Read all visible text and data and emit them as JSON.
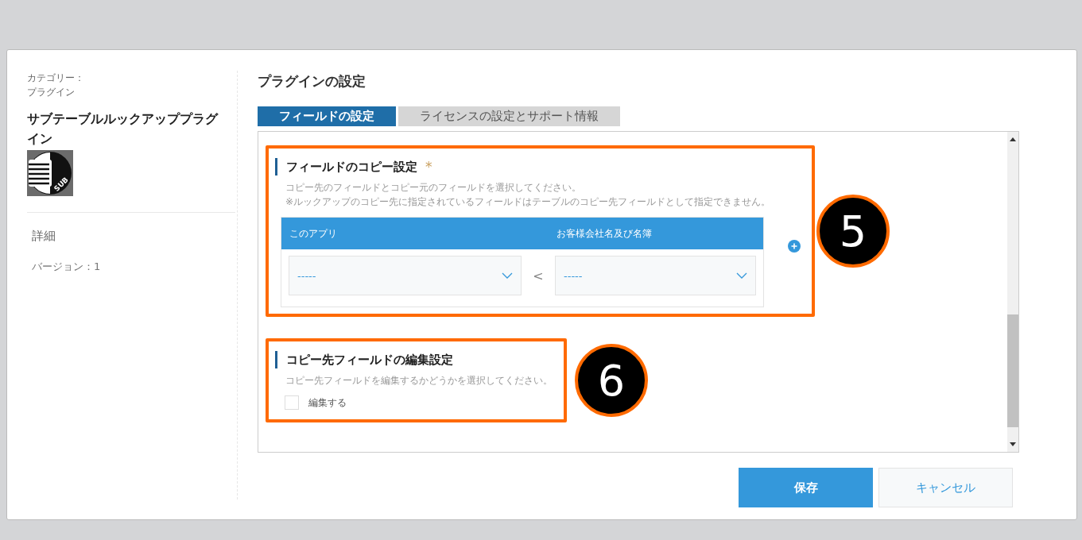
{
  "sidebar": {
    "category_label": "カテゴリー：",
    "category": "プラグイン",
    "plugin_name": "サブテーブルルックアッププラグイン",
    "icon_badge": "SUB",
    "details_heading": "詳細",
    "version": "バージョン：1"
  },
  "page_title": "プラグインの設定",
  "tabs": [
    {
      "label": "フィールドの設定",
      "selected": true
    },
    {
      "label": "ライセンスの設定とサポート情報",
      "selected": false
    }
  ],
  "sections": [
    {
      "kind": "mapping",
      "title": "フィールドのコピー設定",
      "required_mark": "*",
      "callout": "5",
      "descriptions": [
        "コピー先のフィールドとコピー元のフィールドを選択してください。",
        "※ルックアップのコピー先に指定されているフィールドはテーブルのコピー先フィールドとして指定できません。"
      ],
      "table": {
        "columns": [
          "このアプリ",
          "お客様会社名及び名簿"
        ],
        "rows": [
          {
            "target": "-----",
            "arrow": "<",
            "source": "-----"
          }
        ]
      }
    },
    {
      "kind": "checkbox",
      "title": "コピー先フィールドの編集設定",
      "callout": "6",
      "descriptions": [
        "コピー先フィールドを編集するかどうかを選択してください。"
      ],
      "checkbox": {
        "label": "編集する",
        "checked": false
      }
    }
  ],
  "buttons": [
    {
      "label": "保存",
      "kind": "primary"
    },
    {
      "label": "キャンセル",
      "kind": "secondary"
    }
  ]
}
